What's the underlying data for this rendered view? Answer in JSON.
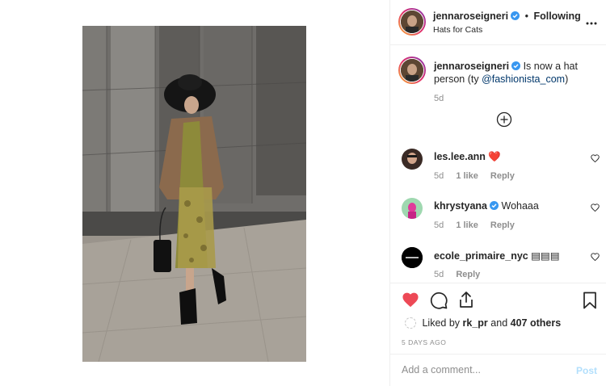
{
  "post": {
    "image_name": "street-style-hat-photo"
  },
  "header": {
    "username": "jennaroseigneri",
    "separator": "•",
    "follow_label": "Following",
    "location": "Hats for Cats",
    "more_icon": "more-options-icon"
  },
  "caption": {
    "username": "jennaroseigneri",
    "text": "Is now a hat person (ty ",
    "mention": "@fashionista_com",
    "text_end": ")",
    "time": "5d",
    "load_more_icon": "plus-circle-icon"
  },
  "comments": [
    {
      "username": "les.lee.ann",
      "text": "❤️",
      "time": "5d",
      "likes": "1 like",
      "reply": "Reply"
    },
    {
      "username": "khrystyana",
      "text": "Wohaaa",
      "time": "5d",
      "likes": "1 like",
      "reply": "Reply"
    },
    {
      "username": "ecole_primaire_nyc",
      "text": "▤▤▤",
      "time": "5d",
      "reply": "Reply"
    }
  ],
  "actions": {
    "liked_by_prefix": "Liked by",
    "liked_by_user": "rk_pr",
    "liked_by_and": "and",
    "liked_by_others": "407 others",
    "date": "5 DAYS AGO"
  },
  "comment_box": {
    "placeholder": "Add a comment...",
    "post_label": "Post"
  },
  "colors": {
    "like_red": "#ed4956",
    "verified_blue": "#3897f0",
    "post_disabled": "#b2dffc"
  }
}
